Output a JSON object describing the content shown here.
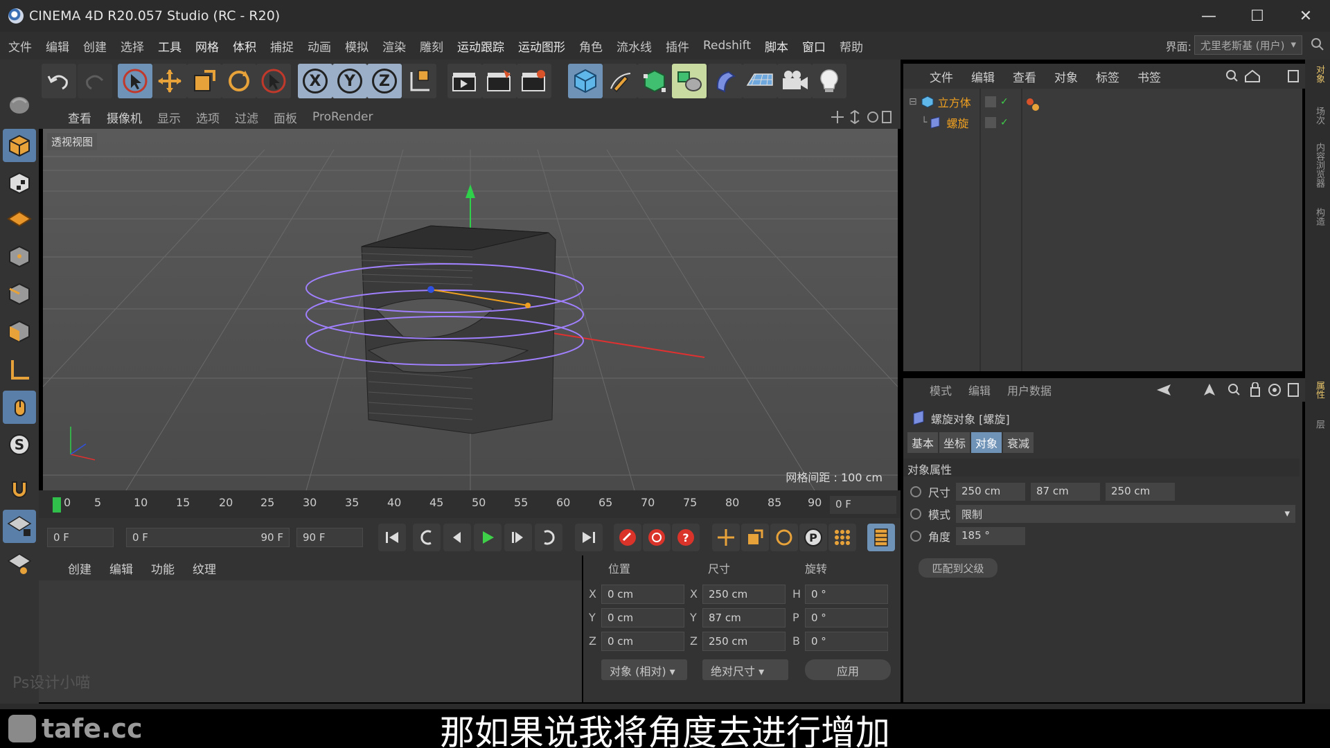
{
  "app": {
    "title": "CINEMA 4D R20.057 Studio (RC - R20)",
    "window_controls": [
      "—",
      "☐",
      "✕"
    ]
  },
  "menubar": {
    "items": [
      "文件",
      "编辑",
      "创建",
      "选择",
      "工具",
      "网格",
      "体积",
      "捕捉",
      "动画",
      "模拟",
      "渲染",
      "雕刻",
      "运动跟踪",
      "运动图形",
      "角色",
      "流水线",
      "插件",
      "Redshift",
      "脚本",
      "窗口",
      "帮助"
    ],
    "layout_label": "界面:",
    "layout_value": "尤里老斯基 (用户)"
  },
  "viewport": {
    "menu": [
      "查看",
      "摄像机",
      "显示",
      "选项",
      "过滤",
      "面板",
      "ProRender"
    ],
    "view_label": "透视视图",
    "grid_spacing": "网格间距 : 100 cm"
  },
  "timeline": {
    "ticks": [
      "0",
      "5",
      "10",
      "15",
      "20",
      "25",
      "30",
      "35",
      "40",
      "45",
      "50",
      "55",
      "60",
      "65",
      "70",
      "75",
      "80",
      "85",
      "90"
    ],
    "current_frame": "0 F"
  },
  "playbar": {
    "start_frame": "0 F",
    "range_start": "0 F",
    "range_end": "90 F",
    "end_frame": "90 F"
  },
  "material_manager": {
    "menu": [
      "创建",
      "编辑",
      "功能",
      "纹理"
    ],
    "watermark": "Ps设计小喵"
  },
  "coordinates": {
    "headers": [
      "位置",
      "尺寸",
      "旋转"
    ],
    "pos": {
      "X": "0 cm",
      "Y": "0 cm",
      "Z": "0 cm"
    },
    "size": {
      "X": "250 cm",
      "Y": "87 cm",
      "Z": "250 cm"
    },
    "rot": {
      "H": "0 °",
      "P": "0 °",
      "B": "0 °"
    },
    "mode_object": "对象 (相对)",
    "mode_size": "绝对尺寸",
    "apply": "应用"
  },
  "object_manager": {
    "menu": [
      "文件",
      "编辑",
      "查看",
      "对象",
      "标签",
      "书签"
    ],
    "objects": [
      {
        "name": "立方体",
        "level": 0
      },
      {
        "name": "螺旋",
        "level": 1
      }
    ]
  },
  "attribute_manager": {
    "menu": [
      "模式",
      "编辑",
      "用户数据"
    ],
    "object_title": "螺旋对象 [螺旋]",
    "tabs": [
      "基本",
      "坐标",
      "对象",
      "衰减"
    ],
    "active_tab": "对象",
    "section": "对象属性",
    "size_label": "尺寸",
    "size": [
      "250 cm",
      "87 cm",
      "250 cm"
    ],
    "mode_label": "模式",
    "mode_value": "限制",
    "angle_label": "角度",
    "angle_value": "185 °",
    "fit_button": "匹配到父级"
  },
  "right_strip": [
    "对象",
    "场次",
    "内容浏览器",
    "构造",
    "属性",
    "层"
  ],
  "subtitle": "那如果说我将角度去进行增加",
  "brand": "tafe.cc"
}
